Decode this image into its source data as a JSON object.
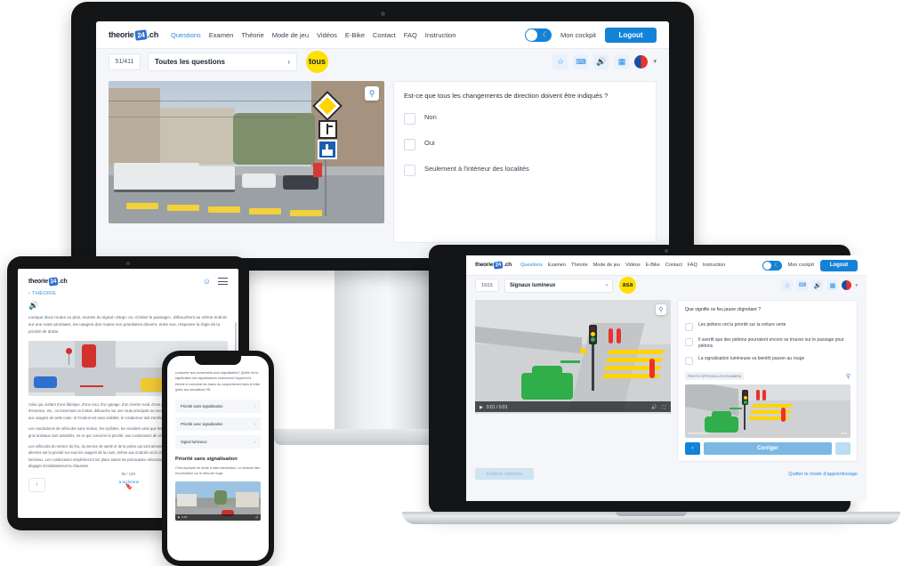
{
  "brand": {
    "name_left": "theorie",
    "name_badge": "24",
    "name_right": ".ch",
    "accent": "#1383d8",
    "yellow": "#ffe000"
  },
  "nav": {
    "links": [
      "Questions",
      "Examen",
      "Théorie",
      "Mode de jeu",
      "Vidéos",
      "E-Bike",
      "Contact",
      "FAQ",
      "Instruction"
    ],
    "active": "Questions",
    "cockpit_label": "Mon cockpit",
    "logout_label": "Logout",
    "toggle_icon": "moon-icon"
  },
  "desktop": {
    "counter": "51/411",
    "category": "Toutes les questions",
    "chevron": "›",
    "bubble": "tous",
    "tools": [
      "star-icon",
      "report-icon",
      "sound-icon",
      "grid-icon",
      "flag-fr-icon",
      "chevron-down-icon"
    ],
    "zoom_icon": "magnifier-icon",
    "question": "Est-ce que tous les changements de direction doivent être indiqués ?",
    "answers": [
      "Non",
      "Oui",
      "Seulement à l'intérieur des localités"
    ]
  },
  "laptop": {
    "counter": "15/15",
    "category": "Signaux lumineux",
    "chevron": "›",
    "bubble": "asa",
    "tools": [
      "star-icon",
      "report-icon",
      "sound-icon",
      "grid-icon",
      "flag-fr-icon",
      "chevron-down-icon"
    ],
    "zoom_icon": "magnifier-icon",
    "video_time": "0:01 / 0:01",
    "play_icon": "play-icon",
    "question": "Que signifie ce feu jaune clignotant ?",
    "answers": [
      "Les piétons ont la priorité sur la voiture verte",
      "Il avertit que des piétons pourraient encore se trouver sur le passage pour piétons",
      "La signalisation lumineuse va bientôt passer au rouge"
    ],
    "photo_tag": "PHOTO OFFICIELLE D'EXAMEN",
    "correct_label": "Corriger",
    "prev_icon": "chevron-left-icon",
    "next_icon": "chevron-right-icon",
    "remove_answer_label": "Enlever réponse",
    "quit_label": "Quitter le mode d'apprentissage",
    "watermark_left": "theorie24.ch",
    "watermark_right": "asa"
  },
  "tablet": {
    "breadcrumb": "‹ THÉORIE",
    "sound_icon": "sound-icon",
    "account_icon": "account-icon",
    "menu_icon": "hamburger-icon",
    "intro": "Lorsque deux routes ou plus, munies du signal «Stop» ou «Cédez le passage», débouchent au même endroit sur une route prioritaire, les usagers des routes non prioritaires doivent, entre eux, respecter la règle de la priorité de droite.",
    "paragraphs": [
      "Celui qui, sortant d'une fabrique, d'une cour, d'un garage, d'un chemin rural, d'une place de stationnement, d'une station d'essence, etc., ou traversant un trottoir, débouche sur une route principale ou secondaire, est tenu d'accorder la priorité aux usagers de cette route. Si l'endroit est sans visibilité, le conducteur doit s'arrêter; au besoin.",
      "Les conducteurs de véhicules sans moteur, les cyclistes, les cavaliers ainsi que les personnes qui poussent et touchent de gros animaux sont assimilés, en ce qui concerne la priorité, aux conducteurs de véhicules à moteur.",
      "Les véhicules du service du feu, du service de santé et de la police qui sont annoncés par un avertisseur à deux sons alternés ont la priorité sur tous les usagers de la route, même aux endroits où la circulation est réglée par des signaux lumineux. Les conducteurs empêcheront sur place toutes les précautions nécessaires lorsqu'il est indispensable de dégager immédiatement la chaussée."
    ],
    "page_counter": "36 / 129",
    "back_to_theory": "à la théorie",
    "bookmark_icon": "bookmark-icon",
    "prev_icon": "chevron-left-icon"
  },
  "phone": {
    "intro": "comporter aux croisements avec signalisation? Quelle est la signification des signalisations lumineuses? Apprend la théorie et consolide les bases du comportement dans le trafic grâce aux simulations 3D.",
    "list": [
      "Priorité sans signalisation",
      "Priorité avec signalisation",
      "Signal lumineux"
    ],
    "chevron": "›",
    "section_title": "Priorité sans signalisation",
    "section_text": "C'est la priorité de droite à cette intersection. Le véhicule bleu est prioritaire sur le véhicule rouge.",
    "video_time": "0:01",
    "play_icon": "play-icon"
  }
}
